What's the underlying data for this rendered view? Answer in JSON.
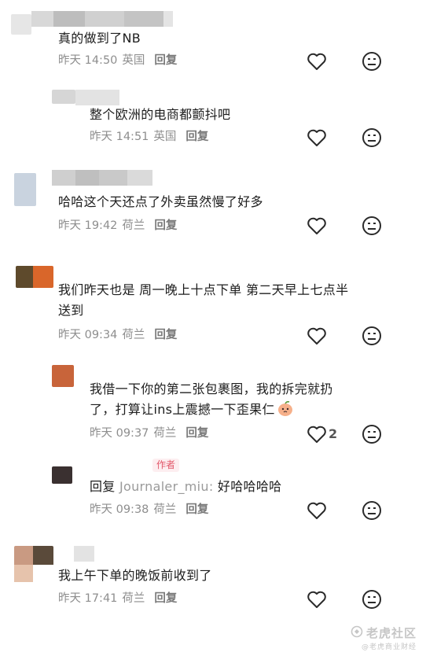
{
  "comments": [
    {
      "text": "真的做到了NB",
      "time": "昨天 14:50",
      "location": "英国",
      "reply": "回复"
    },
    {
      "text": "整个欧洲的电商都颤抖吧",
      "time": "昨天 14:51",
      "location": "英国",
      "reply": "回复"
    },
    {
      "text": "哈哈这个天还点了外卖虽然慢了好多",
      "time": "昨天 19:42",
      "location": "荷兰",
      "reply": "回复"
    },
    {
      "text_line1": "我们昨天也是 周一晚上十点下单 第二天早上七点半",
      "text_line2": "送到",
      "time": "昨天 09:34",
      "location": "荷兰",
      "reply": "回复"
    },
    {
      "text_line1": "我借一下你的第二张包裹图，我的拆完就扔",
      "text_line2": "了，打算让ins上震撼一下歪果仁",
      "emoji": "peach-face-emoji",
      "time": "昨天 09:37",
      "location": "荷兰",
      "reply": "回复",
      "likes": "2"
    },
    {
      "badge": "作者",
      "reply_prefix": "回复",
      "mention": "Journaler_miu:",
      "text": "好哈哈哈哈",
      "time": "昨天 09:38",
      "location": "荷兰",
      "reply": "回复"
    },
    {
      "text": "我上午下单的晚饭前收到了",
      "time": "昨天 17:41",
      "location": "荷兰",
      "reply": "回复"
    }
  ],
  "watermark": {
    "title": "老虎社区",
    "subtitle": "@老虎商业财经"
  }
}
